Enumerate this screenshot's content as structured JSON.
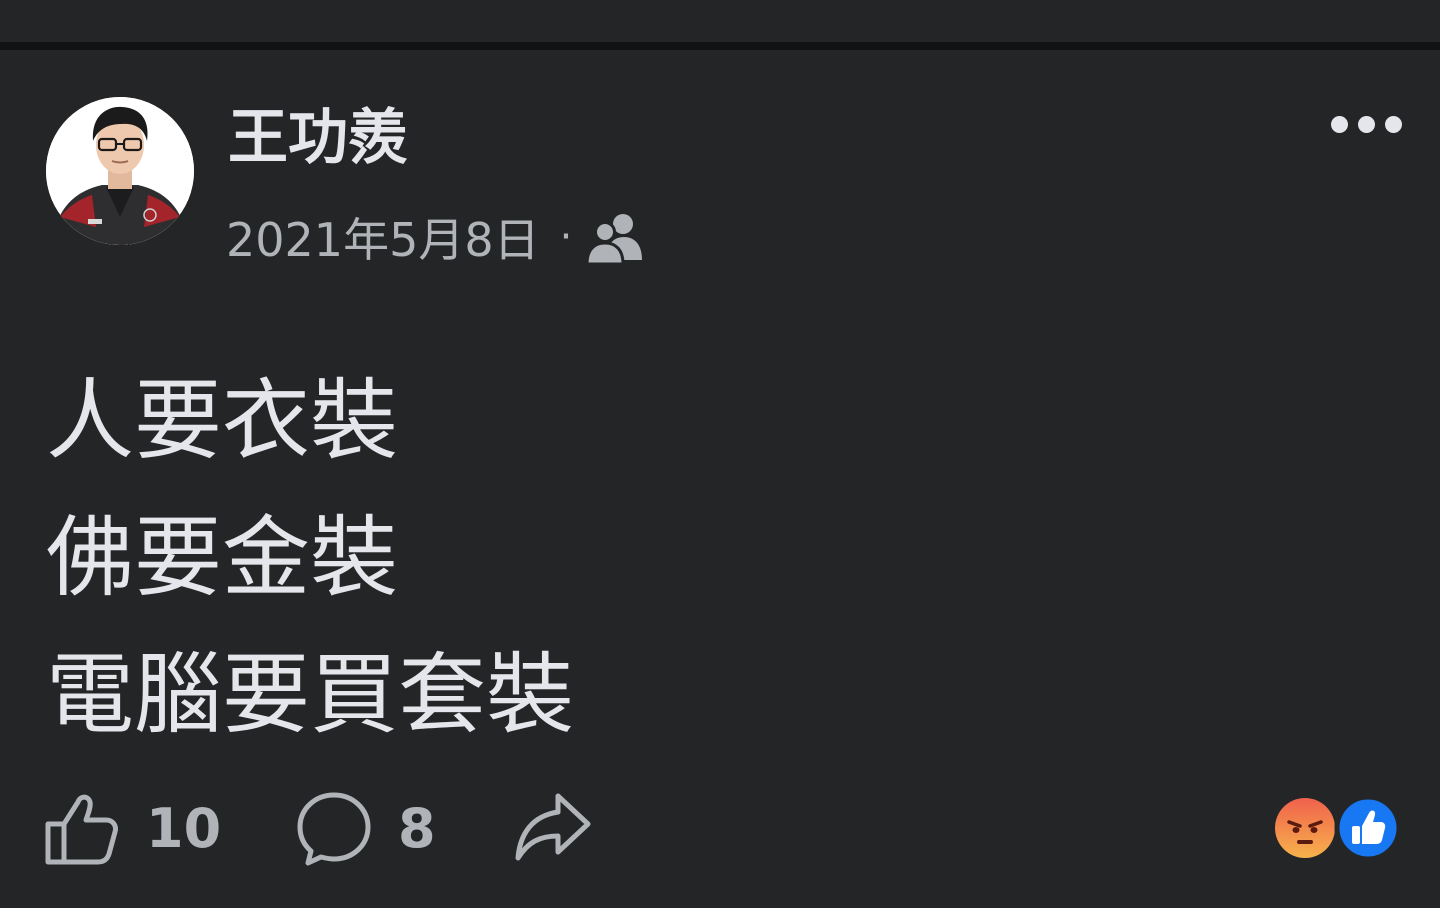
{
  "post": {
    "author": "王功羨",
    "date": "2021年5月8日",
    "separator": "·",
    "audience_icon": "friends-icon",
    "text": "人要衣裝\n佛要金裝\n電腦要買套裝",
    "more_icon": "more-horizontal-icon"
  },
  "actions": {
    "like_count": "10",
    "comment_count": "8",
    "like_icon": "thumbs-up-outline-icon",
    "comment_icon": "speech-bubble-icon",
    "share_icon": "share-arrow-icon"
  },
  "reactions": {
    "icons": [
      "angry-reaction-icon",
      "like-reaction-icon"
    ]
  },
  "colors": {
    "background": "#242526",
    "divider": "#111213",
    "primary_text": "#e4e6eb",
    "secondary_text": "#b0b3b8",
    "like_blue": "#1877f2",
    "angry_orange": "#f0614d"
  }
}
